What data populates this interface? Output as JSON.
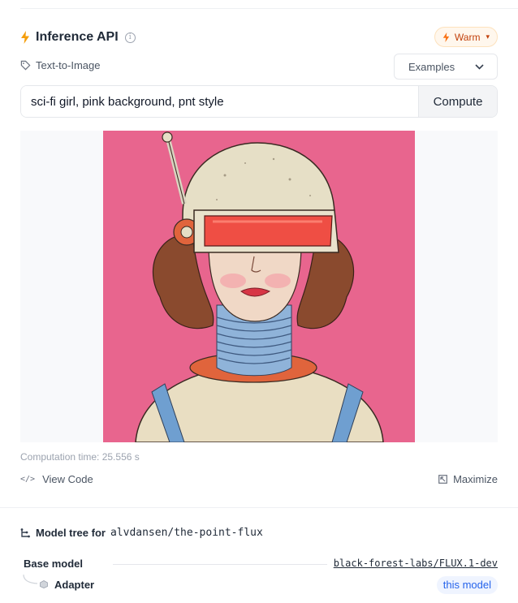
{
  "widget": {
    "title": "Inference API",
    "info_icon": "info-icon",
    "status": {
      "label": "Warm",
      "color": "#f97316"
    },
    "task_label": "Text-to-Image",
    "examples_label": "Examples"
  },
  "prompt": {
    "value": "sci-fi girl, pink background, pnt style",
    "compute_label": "Compute"
  },
  "output": {
    "image_description_icon": "generated-image",
    "computation_time": "Computation time: 25.556 s"
  },
  "actions": {
    "view_code_label": "View Code",
    "maximize_label": "Maximize"
  },
  "model_tree": {
    "title_label": "Model tree for",
    "model_id": "alvdansen/the-point-flux",
    "base_model_label": "Base model",
    "base_model_id": "black-forest-labs/FLUX.1-dev",
    "adapter_label": "Adapter",
    "this_model_label": "this model"
  },
  "colors": {
    "accent_orange": "#f97316",
    "link_blue": "#2563eb",
    "image_background": "#e8658e"
  }
}
